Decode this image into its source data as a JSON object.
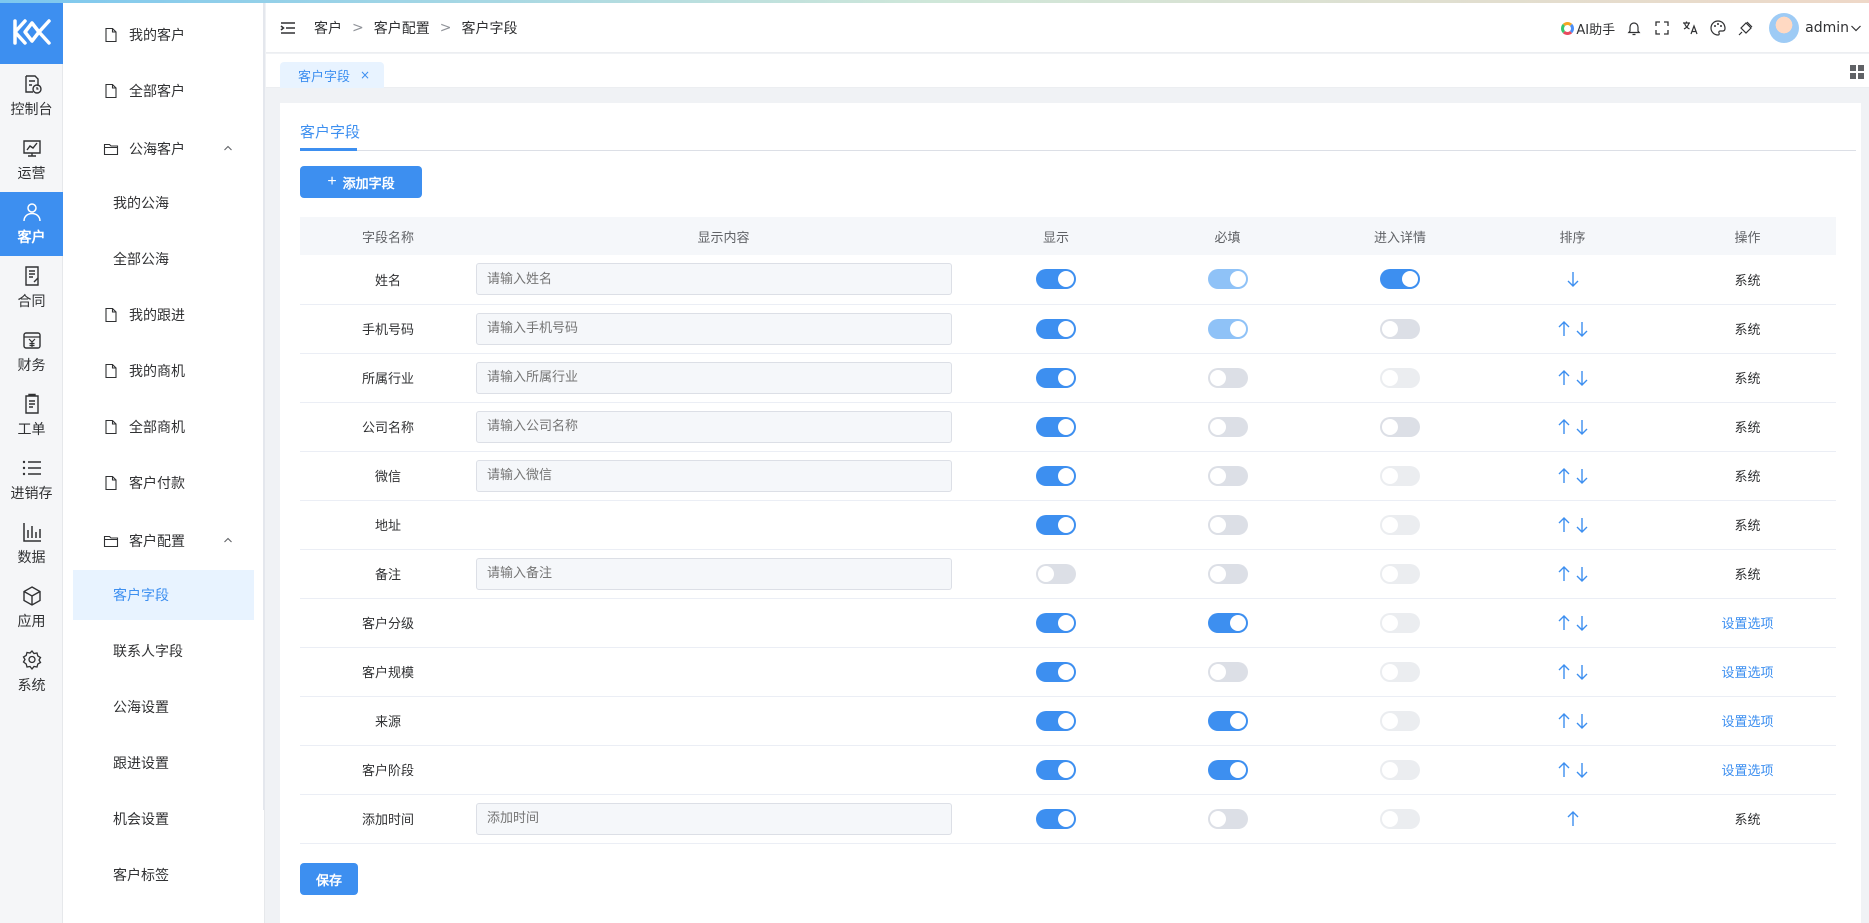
{
  "rail": {
    "items": [
      {
        "label": "控制台",
        "icon": "dashboard-icon"
      },
      {
        "label": "运营",
        "icon": "chart-board-icon"
      },
      {
        "label": "客户",
        "icon": "users-icon"
      },
      {
        "label": "合同",
        "icon": "contract-icon"
      },
      {
        "label": "财务",
        "icon": "finance-icon"
      },
      {
        "label": "工单",
        "icon": "ticket-icon"
      },
      {
        "label": "进销存",
        "icon": "list-icon"
      },
      {
        "label": "数据",
        "icon": "bar-chart-icon"
      },
      {
        "label": "应用",
        "icon": "cube-icon"
      },
      {
        "label": "系统",
        "icon": "gear-icon"
      }
    ]
  },
  "submenu": {
    "items": [
      {
        "label": "我的客户"
      },
      {
        "label": "全部客户"
      },
      {
        "label": "公海客户"
      },
      {
        "label": "我的公海"
      },
      {
        "label": "全部公海"
      },
      {
        "label": "我的跟进"
      },
      {
        "label": "我的商机"
      },
      {
        "label": "全部商机"
      },
      {
        "label": "客户付款"
      },
      {
        "label": "客户配置"
      },
      {
        "label": "客户字段"
      },
      {
        "label": "联系人字段"
      },
      {
        "label": "公海设置"
      },
      {
        "label": "跟进设置"
      },
      {
        "label": "机会设置"
      },
      {
        "label": "客户标签"
      }
    ]
  },
  "header": {
    "breadcrumb": [
      "客户",
      "客户配置",
      "客户字段"
    ],
    "ai_label": "AI助手",
    "user": "admin"
  },
  "tabs": {
    "active": "客户字段",
    "close": "×"
  },
  "page": {
    "tab": "客户字段",
    "add_button": "添加字段",
    "save_button": "保存",
    "columns": [
      "字段名称",
      "显示内容",
      "显示",
      "必填",
      "进入详情",
      "排序",
      "操作"
    ],
    "rows": [
      {
        "name": "姓名",
        "placeholder": "请输入姓名",
        "show": "on",
        "required": "on-dis",
        "detail": "on",
        "up": false,
        "down": true,
        "action": "系统",
        "action_link": false
      },
      {
        "name": "手机号码",
        "placeholder": "请输入手机号码",
        "show": "on",
        "required": "on-dis",
        "detail": "off",
        "up": true,
        "down": true,
        "action": "系统",
        "action_link": false
      },
      {
        "name": "所属行业",
        "placeholder": "请输入所属行业",
        "show": "on",
        "required": "off",
        "detail": "off-dis",
        "up": true,
        "down": true,
        "action": "系统",
        "action_link": false
      },
      {
        "name": "公司名称",
        "placeholder": "请输入公司名称",
        "show": "on",
        "required": "off",
        "detail": "off",
        "up": true,
        "down": true,
        "action": "系统",
        "action_link": false
      },
      {
        "name": "微信",
        "placeholder": "请输入微信",
        "show": "on",
        "required": "off",
        "detail": "off-dis",
        "up": true,
        "down": true,
        "action": "系统",
        "action_link": false
      },
      {
        "name": "地址",
        "placeholder": "",
        "show": "on",
        "required": "off",
        "detail": "off-dis",
        "up": true,
        "down": true,
        "action": "系统",
        "action_link": false
      },
      {
        "name": "备注",
        "placeholder": "请输入备注",
        "show": "off",
        "required": "off",
        "detail": "off-dis",
        "up": true,
        "down": true,
        "action": "系统",
        "action_link": false
      },
      {
        "name": "客户分级",
        "placeholder": "",
        "show": "on",
        "required": "on",
        "detail": "off-dis",
        "up": true,
        "down": true,
        "action": "设置选项",
        "action_link": true
      },
      {
        "name": "客户规模",
        "placeholder": "",
        "show": "on",
        "required": "off",
        "detail": "off-dis",
        "up": true,
        "down": true,
        "action": "设置选项",
        "action_link": true
      },
      {
        "name": "来源",
        "placeholder": "",
        "show": "on",
        "required": "on",
        "detail": "off-dis",
        "up": true,
        "down": true,
        "action": "设置选项",
        "action_link": true
      },
      {
        "name": "客户阶段",
        "placeholder": "",
        "show": "on",
        "required": "on",
        "detail": "off-dis",
        "up": true,
        "down": true,
        "action": "设置选项",
        "action_link": true
      },
      {
        "name": "添加时间",
        "placeholder": "添加时间",
        "show": "on",
        "required": "off",
        "detail": "off-dis",
        "up": true,
        "down": false,
        "action": "系统",
        "action_link": false
      }
    ]
  },
  "colors": {
    "accent": "#3d8ff0",
    "accent_light": "#e8f3ff"
  }
}
